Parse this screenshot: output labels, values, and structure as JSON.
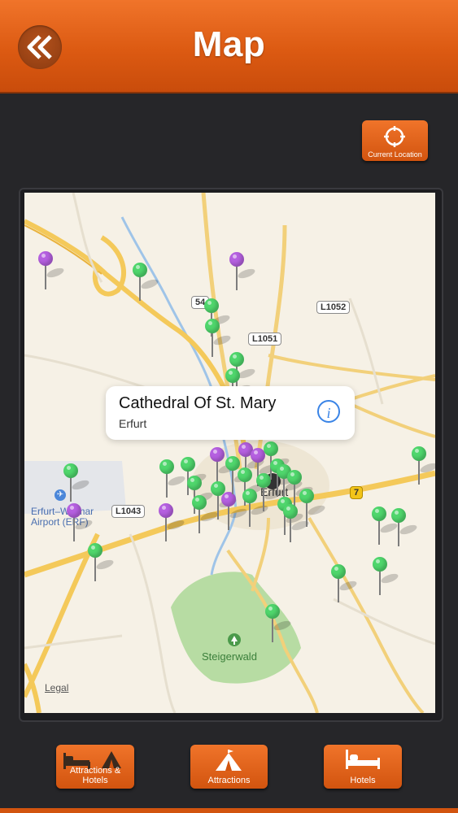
{
  "header": {
    "title": "Map",
    "back_icon": "double-chevron-left-icon",
    "color": "#e0621a"
  },
  "current_location": {
    "label": "Current Location",
    "icon": "crosshair-icon"
  },
  "map": {
    "callout": {
      "title": "Cathedral Of St. Mary",
      "subtitle": "Erfurt",
      "icon": "info-icon"
    },
    "labels": {
      "airport": "Erfurt–Weimar\nAirport (ERF)",
      "forest": "Steigerwald",
      "city": "Erfurt",
      "legal": "Legal"
    },
    "road_shields": [
      "54",
      "L1052",
      "L1051",
      "L1043",
      "7"
    ],
    "pin_colors": {
      "attraction": "#4fd66c",
      "hotel": "#b560e0"
    }
  },
  "bottom_nav": [
    {
      "label": "Attractions & Hotels",
      "icon": "bed-and-tent-icon"
    },
    {
      "label": "Attractions",
      "icon": "tent-icon"
    },
    {
      "label": "Hotels",
      "icon": "bed-icon"
    }
  ]
}
